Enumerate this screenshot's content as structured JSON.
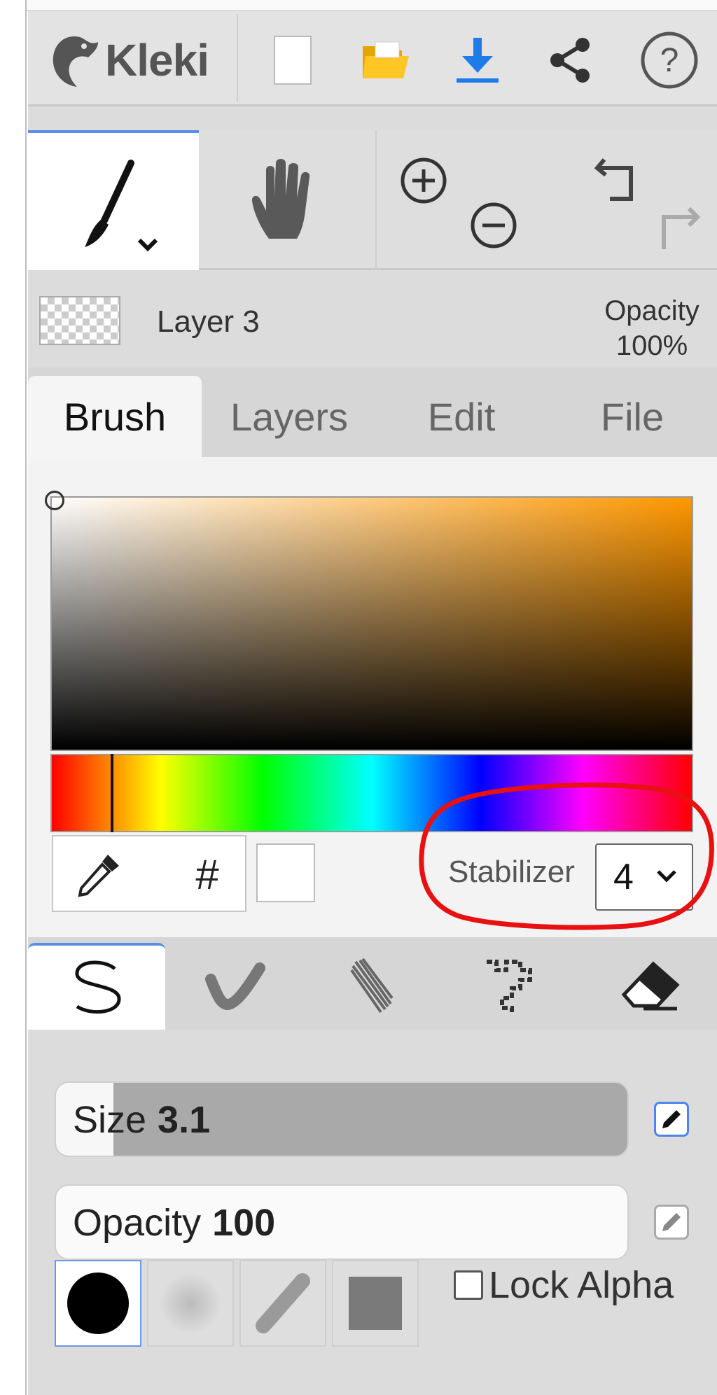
{
  "app": {
    "name": "Kleki"
  },
  "toolbar": {
    "buttons": [
      {
        "icon": "new-file-icon"
      },
      {
        "icon": "folder-open-icon"
      },
      {
        "icon": "download-icon"
      },
      {
        "icon": "share-icon"
      },
      {
        "icon": "help-icon"
      }
    ]
  },
  "tools": {
    "active": "brush",
    "items": [
      {
        "icon": "brush-tool-icon"
      },
      {
        "icon": "hand-tool-icon"
      },
      {
        "icon": "zoom-in-icon"
      },
      {
        "icon": "zoom-out-icon"
      },
      {
        "icon": "undo-icon"
      },
      {
        "icon": "redo-icon"
      }
    ]
  },
  "layer": {
    "name": "Layer 3",
    "opacity_label": "Opacity",
    "opacity_value": "100%"
  },
  "tabs": [
    {
      "label": "Brush",
      "active": true
    },
    {
      "label": "Layers",
      "active": false
    },
    {
      "label": "Edit",
      "active": false
    },
    {
      "label": "File",
      "active": false
    }
  ],
  "color": {
    "hue_hex": "#ff9700",
    "selected_hex": "#ffffff",
    "hex_button": "#"
  },
  "stabilizer": {
    "label": "Stabilizer",
    "value": "4"
  },
  "brush_types": [
    "pen-brush",
    "blend-brush",
    "sketchy-brush",
    "pixel-brush",
    "eraser"
  ],
  "sliders": {
    "size": {
      "label": "Size",
      "value": "3.1",
      "fill_fraction": 0.08
    },
    "opacity": {
      "label": "Opacity",
      "value": "100",
      "fill_fraction": 1.0
    }
  },
  "shapes": [
    "round-hard",
    "round-soft",
    "stroke",
    "square"
  ],
  "lock_alpha": {
    "label": "Lock Alpha",
    "checked": false
  }
}
